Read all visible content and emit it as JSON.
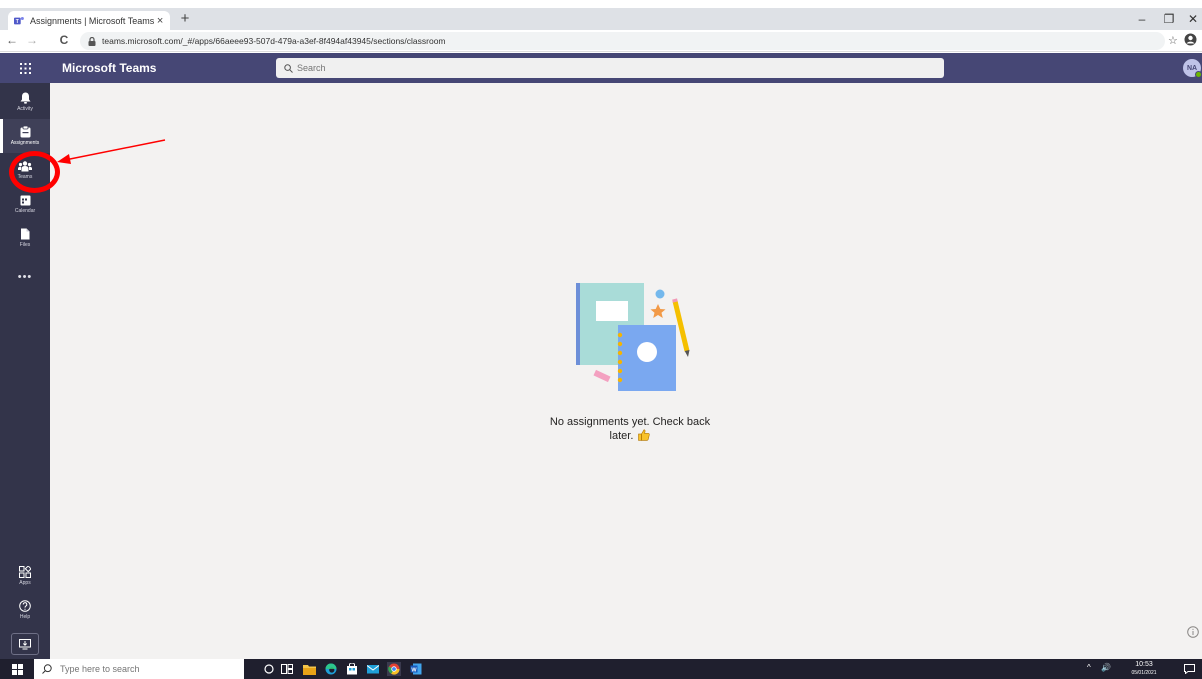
{
  "browser": {
    "tab_title": "Assignments | Microsoft Teams",
    "tab_close": "×",
    "new_tab": "+",
    "url": "teams.microsoft.com/_#/apps/66aeee93-507d-479a-a3ef-8f494af43945/sections/classroom",
    "minimize": "–",
    "restore": "❐",
    "close": "✕",
    "back": "←",
    "forward": "→",
    "reload": "C",
    "bookmark_star": "☆"
  },
  "teams": {
    "app_name": "Microsoft Teams",
    "search_placeholder": "Search",
    "avatar_initials": "NA"
  },
  "rail": {
    "items": [
      {
        "label": "Activity",
        "icon": "bell-icon"
      },
      {
        "label": "Assignments",
        "icon": "assignments-icon",
        "active": true
      },
      {
        "label": "Teams",
        "icon": "teams-icon"
      },
      {
        "label": "Calendar",
        "icon": "calendar-icon"
      },
      {
        "label": "Files",
        "icon": "files-icon"
      }
    ],
    "more": "•••",
    "bottom": [
      {
        "label": "Apps",
        "icon": "apps-icon"
      },
      {
        "label": "Help",
        "icon": "help-icon"
      }
    ]
  },
  "main": {
    "empty_message_line1": "No assignments yet. Check back",
    "empty_message_line2": "later."
  },
  "taskbar": {
    "search_placeholder": "Type here to search",
    "time": "10:53",
    "date": "05/01/2021",
    "tray_chevron": "^",
    "tray_volume": "🔊"
  },
  "colors": {
    "teams_header": "#464775",
    "rail": "#33344a",
    "annotation": "#ff0000",
    "main_bg": "#f3f2f1"
  }
}
